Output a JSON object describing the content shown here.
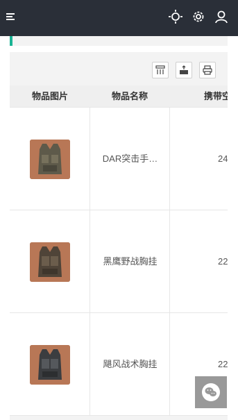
{
  "topbar": {
    "icons": [
      "menu-icon",
      "sun-icon",
      "gear-icon",
      "user-icon"
    ],
    "background": "#2a2f38"
  },
  "toolbar": {
    "icons": [
      "columns-icon",
      "export-icon",
      "print-icon"
    ]
  },
  "table": {
    "headers": {
      "image": "物品图片",
      "name": "物品名称",
      "carry": "携带空"
    },
    "rows": [
      {
        "image_icon": "vest-icon",
        "name": "DAR突击手…",
        "carry": "24"
      },
      {
        "image_icon": "vest-icon",
        "name": "黑鹰野战胸挂",
        "carry": "22"
      },
      {
        "image_icon": "vest-icon",
        "name": "飓风战术胸挂",
        "carry": "22"
      }
    ]
  },
  "floating": {
    "icon": "wechat-icon"
  },
  "colors": {
    "accent": "#1ab394",
    "thumb_bg": "#b87756"
  }
}
